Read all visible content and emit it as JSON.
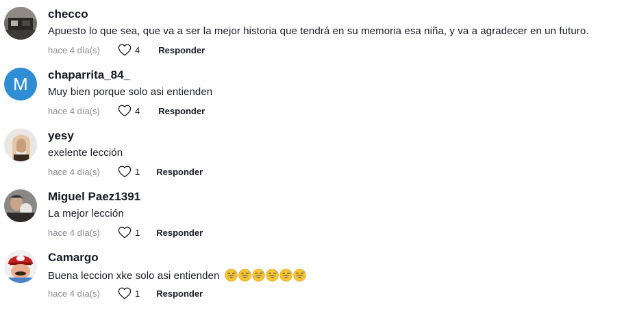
{
  "comments": [
    {
      "username": "checco",
      "text": "Apuesto lo que sea, que va a ser la mejor historia que tendrá en su memoria esa niña, y va a agradecer en un futuro.",
      "time": "hace 4 día(s)",
      "likes": "4",
      "reply_label": "Responder",
      "avatar": {
        "type": "photo",
        "colors": [
          "#6e6a64",
          "#2a2826",
          "#b5b0a8"
        ]
      }
    },
    {
      "username": "chaparrita_84_",
      "text": "Muy bien porque solo asi entienden",
      "time": "hace 4 día(s)",
      "likes": "4",
      "reply_label": "Responder",
      "avatar": {
        "type": "letter",
        "letter": "M",
        "color": "#2f8dd4"
      }
    },
    {
      "username": "yesy",
      "text": "exelente lección",
      "time": "hace 4 día(s)",
      "likes": "1",
      "reply_label": "Responder",
      "avatar": {
        "type": "photo",
        "colors": [
          "#e9e6e4",
          "#c89e7c",
          "#3a2a20"
        ]
      }
    },
    {
      "username": "Miguel Paez1391",
      "text": "La mejor lección",
      "time": "hace 4 día(s)",
      "likes": "1",
      "reply_label": "Responder",
      "avatar": {
        "type": "photo",
        "colors": [
          "#8b8886",
          "#2c2b2a",
          "#c9a48a"
        ]
      }
    },
    {
      "username": "Camargo",
      "text": "Buena leccion xke solo asi entienden",
      "emojis": [
        "grinning-sweat-emoji",
        "grinning-sweat-emoji",
        "grinning-sweat-emoji",
        "grinning-sweat-emoji",
        "grinning-sweat-emoji",
        "grinning-sweat-emoji"
      ],
      "time": "hace 4 día(s)",
      "likes": "1",
      "reply_label": "Responder",
      "avatar": {
        "type": "photo",
        "colors": [
          "#4a80c8",
          "#c42020",
          "#e8b090"
        ]
      }
    }
  ],
  "colors": {
    "text": "#161823",
    "muted": "#8a8b91",
    "avatar_blue": "#2f8dd4"
  }
}
